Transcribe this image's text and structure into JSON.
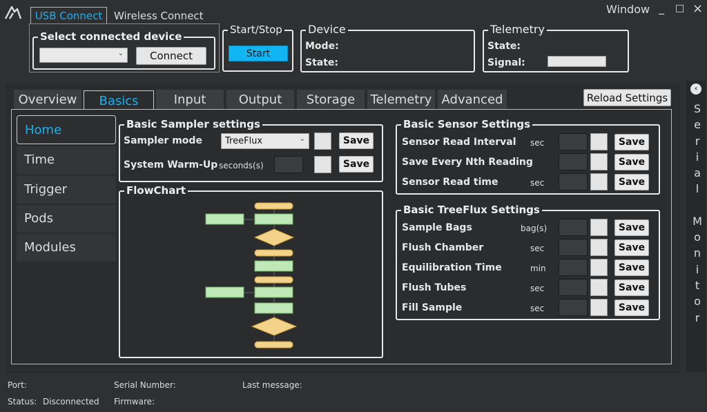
{
  "window": {
    "title": "Window",
    "controls": [
      "_",
      "□",
      "×"
    ]
  },
  "connection_tabs": [
    "USB Connect",
    "Wireless Connect"
  ],
  "select_device": {
    "title": "Select connected device",
    "dropdown_value": "",
    "connect_label": "Connect"
  },
  "start_stop": {
    "title": "Start/Stop",
    "start_label": "Start"
  },
  "device": {
    "title": "Device",
    "mode_label": "Mode:",
    "state_label": "State:"
  },
  "telemetry": {
    "title": "Telemetry",
    "state_label": "State:",
    "signal_label": "Signal:"
  },
  "main_tabs": [
    "Overview",
    "Basics",
    "Input",
    "Output",
    "Storage",
    "Telemetry",
    "Advanced"
  ],
  "reload_label": "Reload Settings",
  "sidebar": [
    "Home",
    "Time",
    "Trigger",
    "Pods",
    "Modules"
  ],
  "basic_sampler": {
    "title": "Basic Sampler settings",
    "mode_label": "Sampler mode",
    "mode_value": "TreeFlux",
    "warmup_label": "System Warm-Up",
    "warmup_unit": "seconds(s)",
    "save": "Save"
  },
  "flowchart": {
    "title": "FlowChart"
  },
  "basic_sensor": {
    "title": "Basic Sensor Settings",
    "rows": [
      {
        "label": "Sensor Read Interval",
        "unit": "sec"
      },
      {
        "label": "Save Every Nth Reading",
        "unit": ""
      },
      {
        "label": "Sensor Read time",
        "unit": "sec"
      }
    ]
  },
  "basic_treeflux": {
    "title": "Basic TreeFlux Settings",
    "rows": [
      {
        "label": "Sample Bags",
        "unit": "bag(s)"
      },
      {
        "label": "Flush Chamber",
        "unit": "sec"
      },
      {
        "label": "Equilibration Time",
        "unit": "min"
      },
      {
        "label": "Flush Tubes",
        "unit": "sec"
      },
      {
        "label": "Fill Sample",
        "unit": "sec"
      }
    ]
  },
  "save_label": "Save",
  "serial_monitor": {
    "label": "Serial Monitor",
    "letters": [
      "S",
      "e",
      "r",
      "i",
      "a",
      "l",
      "",
      "M",
      "o",
      "n",
      "i",
      "t",
      "o",
      "r"
    ]
  },
  "status_bar": {
    "port_label": "Port:",
    "serial_label": "Serial Number:",
    "last_message_label": "Last message:",
    "status_label": "Status:",
    "status_value": "Disconnected",
    "firmware_label": "Firmware:"
  },
  "colors": {
    "accent": "#1ab0f0",
    "start_button": "#10b5f2",
    "background": "#2e3032"
  }
}
